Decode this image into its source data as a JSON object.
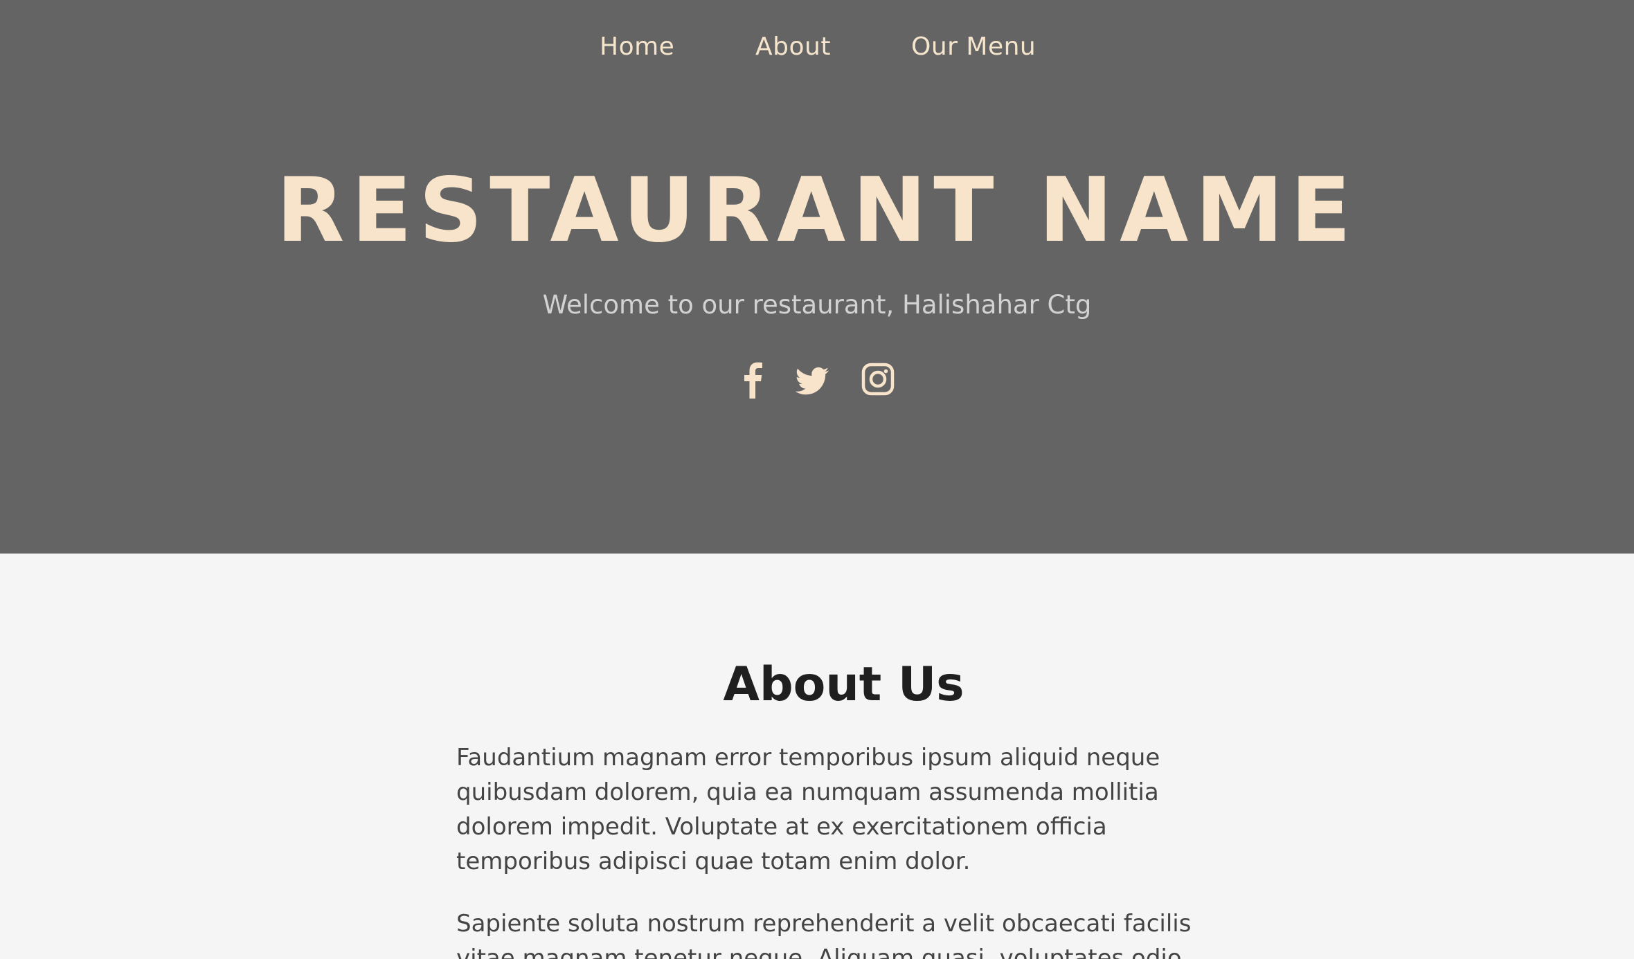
{
  "nav": {
    "items": [
      {
        "label": "Home"
      },
      {
        "label": "About"
      },
      {
        "label": "Our Menu"
      }
    ]
  },
  "hero": {
    "title": "RESTAURANT NAME",
    "subtitle": "Welcome to our restaurant, Halishahar Ctg",
    "social": [
      "facebook-icon",
      "twitter-icon",
      "instagram-icon"
    ]
  },
  "about": {
    "title": "About Us",
    "paragraphs": [
      "Faudantium magnam error temporibus ipsum aliquid neque quibusdam dolorem, quia ea numquam assumenda mollitia dolorem impedit. Voluptate at ex exercitationem officia temporibus adipisci quae totam enim dolor.",
      "Sapiente soluta nostrum reprehenderit a velit obcaecati facilis vitae magnam tenetur neque. Aliquam quasi, voluptates odio"
    ]
  },
  "colors": {
    "hero_bg": "#646464",
    "accent": "#f8e4cb",
    "page_bg": "#f5f5f5",
    "heading": "#1f1f1f",
    "body_text": "#444444"
  }
}
